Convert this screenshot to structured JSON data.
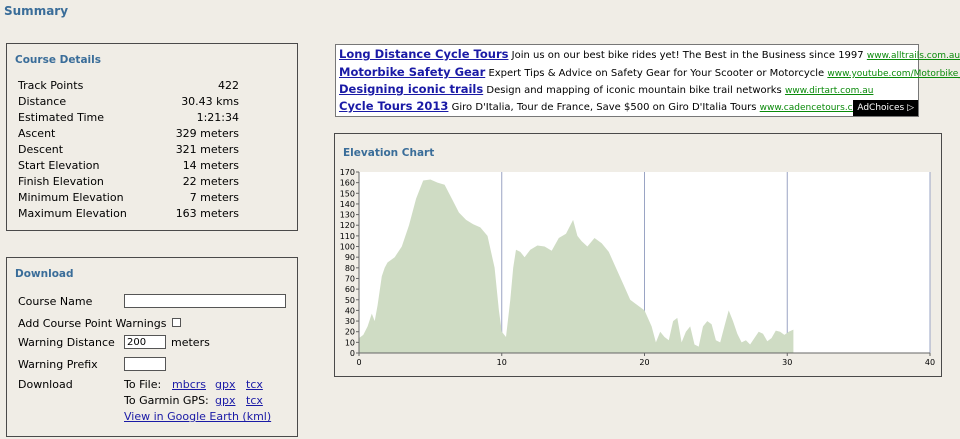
{
  "page_title": "Summary",
  "course_details": {
    "heading": "Course Details",
    "rows": [
      {
        "label": "Track Points",
        "value": "422"
      },
      {
        "label": "Distance",
        "value": "30.43 kms"
      },
      {
        "label": "Estimated Time",
        "value": "1:21:34"
      },
      {
        "label": "Ascent",
        "value": "329 meters"
      },
      {
        "label": "Descent",
        "value": "321 meters"
      },
      {
        "label": "Start Elevation",
        "value": "14 meters"
      },
      {
        "label": "Finish Elevation",
        "value": "22 meters"
      },
      {
        "label": "Minimum Elevation",
        "value": "7 meters"
      },
      {
        "label": "Maximum Elevation",
        "value": "163 meters"
      }
    ]
  },
  "download": {
    "heading": "Download",
    "course_name_label": "Course Name",
    "course_name_value": "",
    "warnings_label": "Add Course Point Warnings",
    "warnings_checked": false,
    "warning_distance_label": "Warning Distance",
    "warning_distance_value": "200",
    "warning_distance_unit": "meters",
    "warning_prefix_label": "Warning Prefix",
    "warning_prefix_value": "",
    "download_label": "Download",
    "to_file_label": "To File:",
    "to_file_links": [
      "mbcrs",
      "gpx",
      "tcx"
    ],
    "garmin_label": "To Garmin GPS:",
    "garmin_links": [
      "gpx",
      "tcx"
    ],
    "google_earth_link": "View in Google Earth (kml)"
  },
  "ads": {
    "items": [
      {
        "headline": "Long Distance Cycle Tours",
        "text": "Join us on our best bike rides yet! The Best in the Business since 1997",
        "url": "www.alltrails.com.au"
      },
      {
        "headline": "Motorbike Safety Gear",
        "text": "Expert Tips & Advice on Safety Gear for Your Scooter or Motorcycle",
        "url": "www.youtube.com/Motorbike_Safety"
      },
      {
        "headline": "Designing iconic trails",
        "text": "Design and mapping of iconic mountain bike trail networks",
        "url": "www.dirtart.com.au"
      },
      {
        "headline": "Cycle Tours 2013",
        "text": "Giro D'Italia, Tour de France, Save $500 on Giro D'Italia Tours",
        "url": "www.cadencetours.com.au"
      }
    ],
    "adchoices_label": "AdChoices ▷"
  },
  "elevation_chart": {
    "heading": "Elevation Chart"
  },
  "chart_data": {
    "type": "area",
    "title": "",
    "xlabel": "",
    "ylabel": "",
    "xlim": [
      0,
      40
    ],
    "ylim": [
      0,
      170
    ],
    "x_ticks": [
      0,
      10,
      20,
      30,
      40
    ],
    "y_ticks": [
      0,
      10,
      20,
      30,
      40,
      50,
      60,
      70,
      80,
      90,
      100,
      110,
      120,
      130,
      140,
      150,
      160,
      170
    ],
    "grid": true,
    "fill_color": "#cfdcc4",
    "series": [
      {
        "x": [
          0,
          0.3,
          0.6,
          0.9,
          1.1,
          1.3,
          1.6,
          1.8,
          2.0,
          2.5,
          3.0,
          3.5,
          4.0,
          4.5,
          5.0,
          5.5,
          6.0,
          6.5,
          7.0,
          7.5,
          8.0,
          8.5,
          9.0,
          9.5,
          9.8,
          10.0,
          10.3,
          10.6,
          10.8,
          11.0,
          11.3,
          11.6,
          12.0,
          12.5,
          13.0,
          13.5,
          14.0,
          14.5,
          15.0,
          15.3,
          15.6,
          16.0,
          16.5,
          17.0,
          17.5,
          18.0,
          18.5,
          19.0,
          19.5,
          20.0,
          20.5,
          20.8,
          21.1,
          21.4,
          21.7,
          22.0,
          22.3,
          22.6,
          22.9,
          23.2,
          23.5,
          23.8,
          24.1,
          24.4,
          24.7,
          25.0,
          25.3,
          25.6,
          25.9,
          26.2,
          26.5,
          26.8,
          27.1,
          27.4,
          27.7,
          28.0,
          28.3,
          28.6,
          28.9,
          29.2,
          29.5,
          29.8,
          30.1,
          30.43
        ],
        "y": [
          14,
          17,
          25,
          37,
          30,
          45,
          72,
          80,
          85,
          90,
          100,
          120,
          145,
          162,
          163,
          160,
          158,
          145,
          132,
          125,
          121,
          118,
          110,
          80,
          40,
          20,
          15,
          50,
          80,
          97,
          95,
          90,
          97,
          101,
          100,
          96,
          108,
          112,
          125,
          110,
          105,
          100,
          108,
          103,
          95,
          80,
          65,
          50,
          45,
          40,
          25,
          10,
          20,
          15,
          12,
          30,
          33,
          10,
          20,
          25,
          8,
          6,
          25,
          30,
          27,
          12,
          10,
          25,
          40,
          30,
          18,
          10,
          12,
          8,
          14,
          20,
          18,
          11,
          14,
          21,
          20,
          17,
          20,
          22
        ]
      }
    ]
  }
}
